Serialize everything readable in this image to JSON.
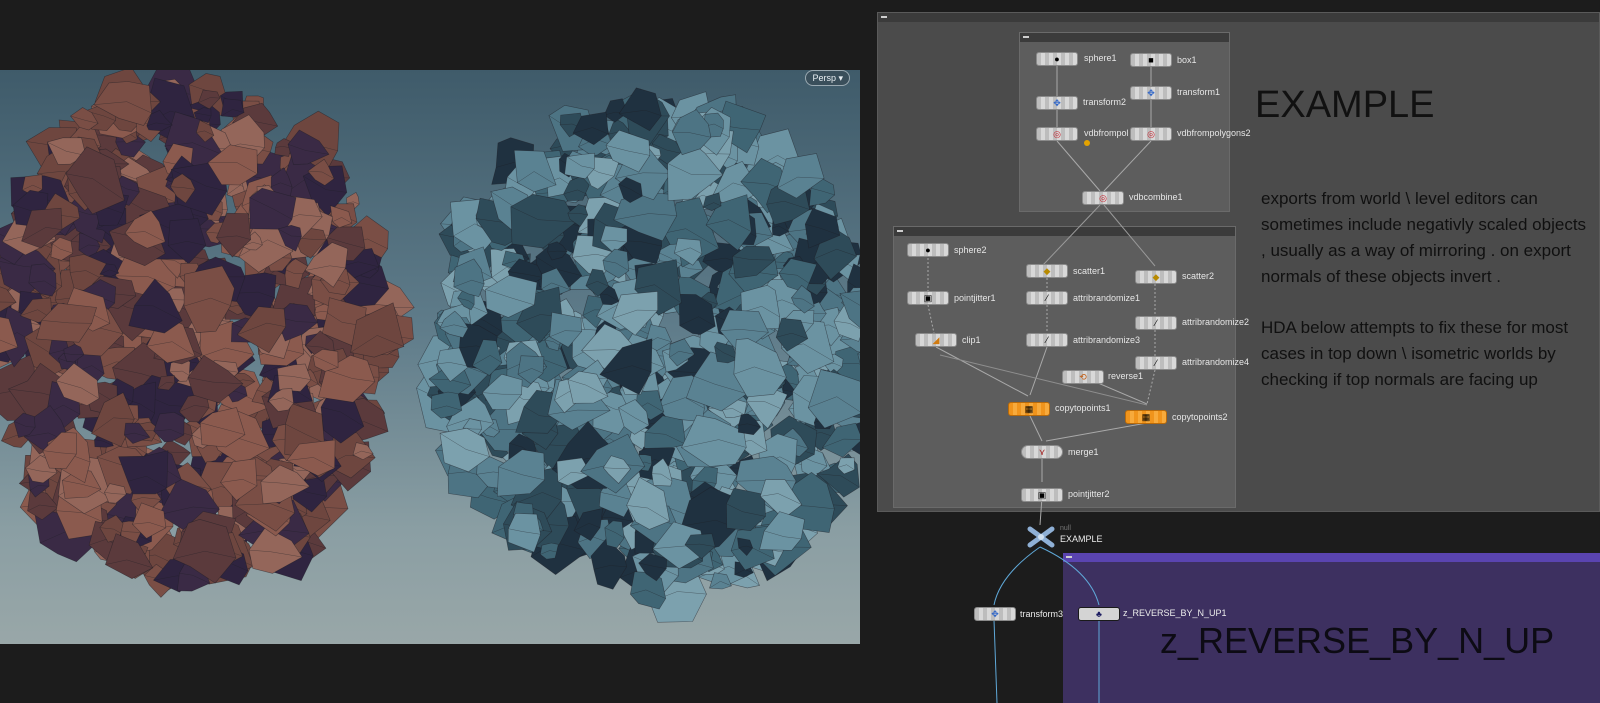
{
  "viewport": {
    "camera_menu": "Persp"
  },
  "network": {
    "example_title": "EXAMPLE",
    "notes": [
      "exports from world \\ level editors can sometimes include negativly scaled objects , usually as a way of mirroring . on export normals of these objects invert .",
      "HDA below attempts to fix these for most cases in top down \\ isometric worlds by checking if top normals are facing up"
    ],
    "hda_title": "z_REVERSE_BY_N_UP",
    "nodes": {
      "sphere1": "sphere1",
      "box1": "box1",
      "transform2": "transform2",
      "transform1": "transform1",
      "vdbfrompolygons1": "vdbfrompol",
      "vdbfrompolygons2": "vdbfrompolygons2",
      "vdbcombine1": "vdbcombine1",
      "sphere2": "sphere2",
      "scatter1": "scatter1",
      "scatter2": "scatter2",
      "pointjitter1": "pointjitter1",
      "attribrandomize1": "attribrandomize1",
      "attribrandomize2": "attribrandomize2",
      "clip1": "clip1",
      "attribrandomize3": "attribrandomize3",
      "attribrandomize4": "attribrandomize4",
      "reverse1": "reverse1",
      "copytopoints1": "copytopoints1",
      "copytopoints2": "copytopoints2",
      "merge1": "merge1",
      "pointjitter2": "pointjitter2",
      "example_null": "EXAMPLE",
      "example_null_type": "null",
      "transform3": "transform3",
      "reverse_hda": "z_REVERSE_BY_N_UP1"
    },
    "icons": [
      "sphere-icon",
      "box-icon",
      "transform-icon",
      "vdb-icon",
      "scatter-icon",
      "jitter-icon",
      "attrib-icon",
      "clip-icon",
      "reverse-icon",
      "copy-icon",
      "merge-icon",
      "null-icon",
      "hda-icon"
    ]
  },
  "colors": {
    "purple_box": "#3d3060",
    "orange_node": "#f0941c",
    "left_mesh": "#7a4e45",
    "right_mesh": "#4d7484"
  }
}
